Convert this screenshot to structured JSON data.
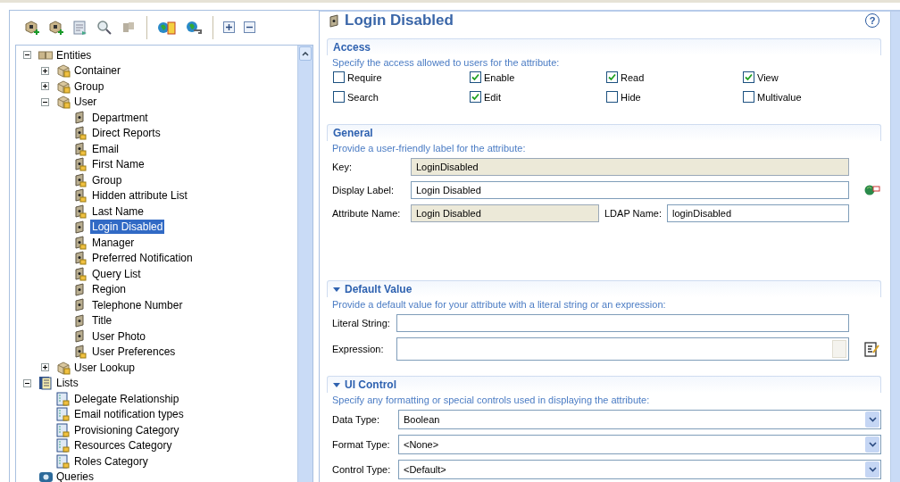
{
  "tree": {
    "items": [
      {
        "label": "Entities",
        "kind": "entities",
        "selected": false,
        "expanded": true,
        "children": [
          {
            "label": "Container",
            "kind": "entity",
            "selected": false,
            "expanded": false
          },
          {
            "label": "Group",
            "kind": "entity",
            "selected": false,
            "expanded": false
          },
          {
            "label": "User",
            "kind": "entity",
            "selected": false,
            "expanded": true,
            "children": [
              {
                "label": "Department",
                "kind": "attribute",
                "selected": false
              },
              {
                "label": "Direct Reports",
                "kind": "locked",
                "selected": false
              },
              {
                "label": "Email",
                "kind": "locked",
                "selected": false
              },
              {
                "label": "First Name",
                "kind": "locked",
                "selected": false
              },
              {
                "label": "Group",
                "kind": "locked",
                "selected": false
              },
              {
                "label": "Hidden attribute List",
                "kind": "locked",
                "selected": false
              },
              {
                "label": "Last Name",
                "kind": "locked",
                "selected": false
              },
              {
                "label": "Login Disabled",
                "kind": "attribute",
                "selected": true
              },
              {
                "label": "Manager",
                "kind": "locked",
                "selected": false
              },
              {
                "label": "Preferred Notification",
                "kind": "locked",
                "selected": false
              },
              {
                "label": "Query List",
                "kind": "locked",
                "selected": false
              },
              {
                "label": "Region",
                "kind": "attribute",
                "selected": false
              },
              {
                "label": "Telephone Number",
                "kind": "attribute",
                "selected": false
              },
              {
                "label": "Title",
                "kind": "attribute",
                "selected": false
              },
              {
                "label": "User Photo",
                "kind": "attribute",
                "selected": false
              },
              {
                "label": "User Preferences",
                "kind": "locked",
                "selected": false
              }
            ]
          },
          {
            "label": "User Lookup",
            "kind": "entity",
            "selected": false,
            "expanded": false
          }
        ]
      },
      {
        "label": "Lists",
        "kind": "lists",
        "selected": false,
        "expanded": true,
        "children": [
          {
            "label": "Delegate Relationship",
            "kind": "list",
            "selected": false
          },
          {
            "label": "Email notification types",
            "kind": "list",
            "selected": false
          },
          {
            "label": "Provisioning Category",
            "kind": "list",
            "selected": false
          },
          {
            "label": "Resources Category",
            "kind": "list",
            "selected": false
          },
          {
            "label": "Roles Category",
            "kind": "list",
            "selected": false
          }
        ]
      },
      {
        "label": "Queries",
        "kind": "queries",
        "selected": false
      }
    ]
  },
  "editor": {
    "title": "Login Disabled",
    "help": "?",
    "sections": [
      {
        "kind": "checkboxes",
        "title": "Access",
        "description": "Specify the access allowed to users for the attribute:",
        "options": [
          {
            "label": "Require",
            "checked": false
          },
          {
            "label": "Enable",
            "checked": true
          },
          {
            "label": "Read",
            "checked": true
          },
          {
            "label": "View",
            "checked": true
          },
          {
            "label": "Search",
            "checked": false
          },
          {
            "label": "Edit",
            "checked": true
          },
          {
            "label": "Hide",
            "checked": false
          },
          {
            "label": "Multivalue",
            "checked": false
          }
        ]
      },
      {
        "kind": "fields",
        "title": "General",
        "description": "Provide a user-friendly label for the attribute:",
        "rows": [
          {
            "kind": "plain",
            "fields": [
              {
                "label": "Key:",
                "kind": "text",
                "value": "LoginDisabled",
                "disabled": true
              }
            ]
          },
          {
            "kind": "mapped",
            "fields": [
              {
                "label": "Display Label:",
                "kind": "text",
                "value": "Login Disabled",
                "disabled": false
              }
            ]
          },
          {
            "kind": "plain",
            "fields": [
              {
                "label": "Attribute Name:",
                "kind": "text",
                "value": "Login Disabled",
                "disabled": true
              },
              {
                "label": "LDAP Name:",
                "kind": "text",
                "value": "loginDisabled",
                "disabled": false
              }
            ]
          }
        ]
      },
      {
        "kind": "fields",
        "title": "Default Value",
        "expanded": true,
        "description": "Provide a default value for your attribute with a literal string or an expression:",
        "rows": [
          {
            "kind": "plain",
            "fields": [
              {
                "label": "Literal String:",
                "kind": "text"
              }
            ]
          },
          {
            "kind": "expression",
            "fields": [
              {
                "label": "Expression:",
                "kind": "multiline"
              }
            ]
          }
        ]
      },
      {
        "kind": "fields",
        "title": "UI Control",
        "expanded": true,
        "description": "Specify any formatting or special controls used in displaying the attribute:",
        "rows": [
          {
            "kind": "select",
            "fields": [
              {
                "label": "Data Type:",
                "kind": "select",
                "value": "Boolean"
              }
            ]
          },
          {
            "kind": "select",
            "fields": [
              {
                "label": "Format Type:",
                "kind": "select",
                "value": "<None>"
              }
            ]
          },
          {
            "kind": "select",
            "fields": [
              {
                "label": "Control Type:",
                "kind": "select",
                "value": "<Default>"
              }
            ]
          }
        ]
      }
    ]
  }
}
